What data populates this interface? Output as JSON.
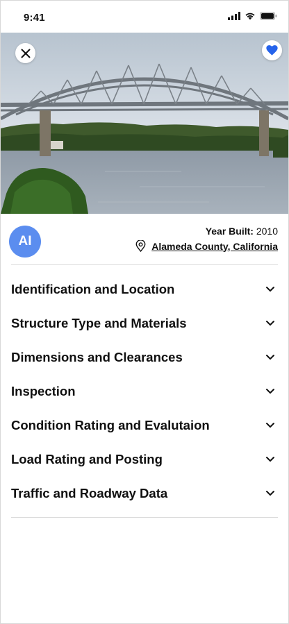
{
  "status_bar": {
    "time": "9:41"
  },
  "hero": {
    "image_description_icon": "bridge-photo",
    "close_icon": "close-icon",
    "favorite_icon": "heart-icon",
    "favorite_color": "#2563eb"
  },
  "info": {
    "avatar_initials": "AI",
    "avatar_color": "#5b8def",
    "year_label": "Year Built:",
    "year_value": "2010",
    "location": "Alameda County, California",
    "location_icon": "map-pin-icon"
  },
  "sections": [
    {
      "label": "Identification and Location"
    },
    {
      "label": "Structure Type and Materials"
    },
    {
      "label": "Dimensions and Clearances"
    },
    {
      "label": "Inspection"
    },
    {
      "label": "Condition Rating and Evalutaion"
    },
    {
      "label": "Load Rating and Posting"
    },
    {
      "label": "Traffic and Roadway Data"
    }
  ]
}
